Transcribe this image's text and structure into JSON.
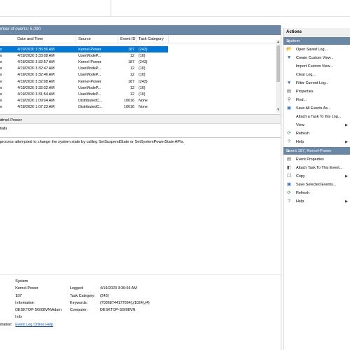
{
  "log_header": "mber of events: 5,090",
  "columns": [
    "Date and Time",
    "Source",
    "Event ID",
    "Task Category"
  ],
  "rows": [
    {
      "level": "o",
      "date": "4/19/2020 3:36:56 AM",
      "source": "Kernel-Power",
      "id": "187",
      "task": "(243)",
      "selected": true
    },
    {
      "level": "o",
      "date": "4/19/2020 3:33:08 AM",
      "source": "UserModeP...",
      "id": "12",
      "task": "(10)"
    },
    {
      "level": "o",
      "date": "4/19/2020 3:32:57 AM",
      "source": "Kernel-Power",
      "id": "187",
      "task": "(243)"
    },
    {
      "level": "o",
      "date": "4/19/2020 3:32:47 AM",
      "source": "UserModeP...",
      "id": "12",
      "task": "(10)"
    },
    {
      "level": "o",
      "date": "4/19/2020 3:32:46 AM",
      "source": "UserModeP...",
      "id": "12",
      "task": "(10)"
    },
    {
      "level": "o",
      "date": "4/19/2020 3:32:08 AM",
      "source": "Kernel-Power",
      "id": "187",
      "task": "(243)"
    },
    {
      "level": "o",
      "date": "4/19/2020 3:32:02 AM",
      "source": "UserModeP...",
      "id": "12",
      "task": "(10)"
    },
    {
      "level": "o",
      "date": "4/19/2020 3:31:54 AM",
      "source": "UserModeP...",
      "id": "12",
      "task": "(10)"
    },
    {
      "level": "o",
      "date": "4/19/2020 1:09:04 AM",
      "source": "DistributedC...",
      "id": "10016",
      "task": "None"
    },
    {
      "level": "o",
      "date": "4/19/2020 1:07:23 AM",
      "source": "DistributedC...",
      "id": "10016",
      "task": "None"
    }
  ],
  "detail": {
    "title": "ernel-Power",
    "tab": "tails",
    "description": "process attempted to change the system state by calling SetSuspendState or SetSystemPowerState APIs.",
    "props": {
      "log_name": "System",
      "source": "Kernel-Power",
      "event_id": "187",
      "level": "Information",
      "user": "DESKTOP-SGI08VN\\Adam",
      "opcode": "Info",
      "more_info_label": "mation:",
      "more_info_link": "Event Log Online Help",
      "logged_label": "Logged:",
      "logged": "4/19/2020 3:36:56 AM",
      "task_label": "Task Category:",
      "task": "(243)",
      "keywords_label": "Keywords:",
      "keywords": "(70368744177664),(1024),(4)",
      "computer_label": "Computer:",
      "computer": "DESKTOP-SGI08VN"
    }
  },
  "actions": {
    "title": "Actions",
    "section1": "System",
    "items1": [
      {
        "icon": "folder-icon",
        "glyph": "📂",
        "label": "Open Saved Log..."
      },
      {
        "icon": "filter-icon",
        "glyph": "▼",
        "label": "Create Custom View..."
      },
      {
        "icon": "blank-icon",
        "glyph": "",
        "label": "Import Custom View..."
      },
      {
        "icon": "blank-icon",
        "glyph": "",
        "label": "Clear Log..."
      },
      {
        "icon": "filter-icon",
        "glyph": "▼",
        "label": "Filter Current Log..."
      },
      {
        "icon": "properties-icon",
        "glyph": "▤",
        "label": "Properties"
      },
      {
        "icon": "find-icon",
        "glyph": "⚲",
        "label": "Find..."
      },
      {
        "icon": "save-icon",
        "glyph": "▣",
        "label": "Save All Events As..."
      },
      {
        "icon": "blank-icon",
        "glyph": "",
        "label": "Attach a Task To this Log..."
      },
      {
        "icon": "blank-icon",
        "glyph": "",
        "label": "View",
        "chevron": true
      },
      {
        "icon": "refresh-icon",
        "glyph": "⟳",
        "label": "Refresh"
      },
      {
        "icon": "help-icon",
        "glyph": "?",
        "label": "Help",
        "chevron": true
      }
    ],
    "section2": "Event 187, Kernel-Power",
    "items2": [
      {
        "icon": "event-properties-icon",
        "glyph": "▤",
        "label": "Event Properties"
      },
      {
        "icon": "attach-task-icon",
        "glyph": "◧",
        "label": "Attach Task To This Event..."
      },
      {
        "icon": "copy-icon",
        "glyph": "❐",
        "label": "Copy",
        "chevron": true
      },
      {
        "icon": "save-icon",
        "glyph": "▣",
        "label": "Save Selected Events..."
      },
      {
        "icon": "refresh-icon",
        "glyph": "⟳",
        "label": "Refresh"
      },
      {
        "icon": "help-icon",
        "glyph": "?",
        "label": "Help",
        "chevron": true
      }
    ]
  },
  "colors": {
    "accent": "#0078d7",
    "section": "#6b87a6",
    "link": "#0b57d0"
  }
}
